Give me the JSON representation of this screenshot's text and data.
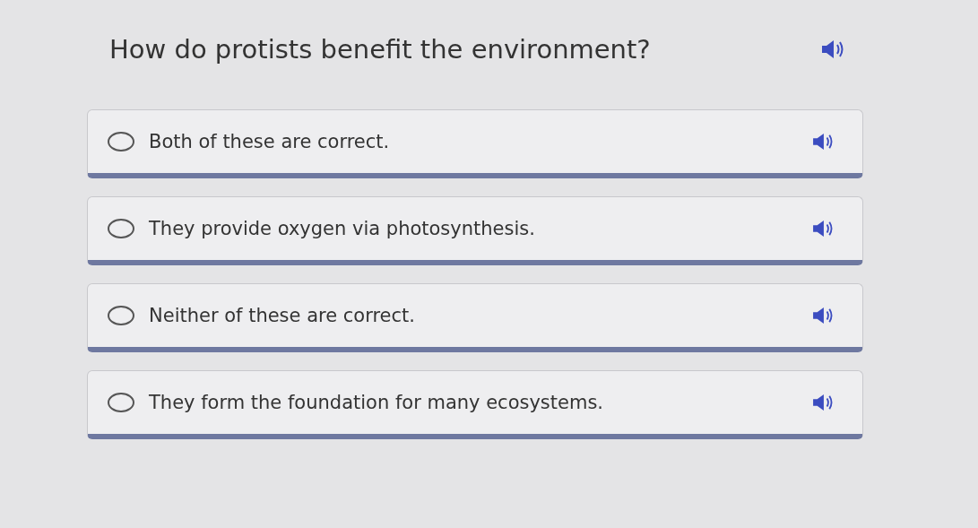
{
  "question": "How do protists benefit the environment?",
  "options": [
    {
      "text": "Both of these are correct.",
      "selected": false
    },
    {
      "text": "They provide oxygen via photosynthesis.",
      "selected": false
    },
    {
      "text": "Neither of these are correct.",
      "selected": false
    },
    {
      "text": "They form the foundation for many ecosystems.",
      "selected": false
    }
  ]
}
